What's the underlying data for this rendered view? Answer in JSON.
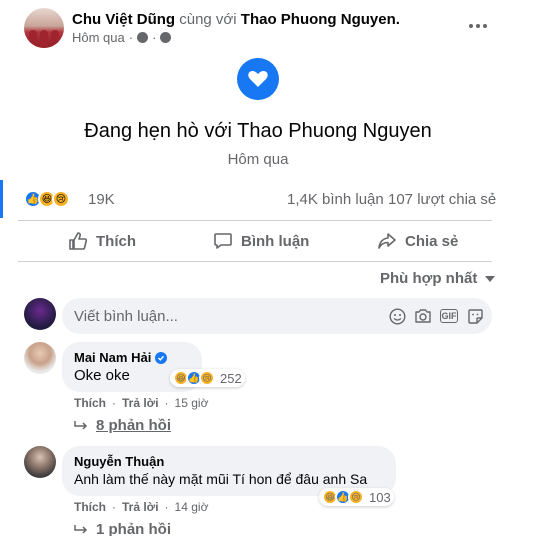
{
  "post": {
    "author": "Chu Việt Dũng",
    "with_word": "cùng với",
    "tagged": "Thao Phuong Nguyen",
    "time": "Hôm qua",
    "more_icon": "more-horizontal-icon"
  },
  "life_event": {
    "title": "Đang hẹn hò với Thao Phuong Nguyen",
    "date": "Hôm qua",
    "icon": "heart-icon"
  },
  "stats": {
    "reactions": "19K",
    "comments": "1,4K bình luận",
    "shares": "107 lượt chia sẻ"
  },
  "actions": {
    "like": "Thích",
    "comment": "Bình luận",
    "share": "Chia sẻ"
  },
  "sort": {
    "label": "Phù hợp nhất"
  },
  "composer": {
    "placeholder": "Viết bình luận..."
  },
  "comments": [
    {
      "name": "Mai Nam Hải",
      "verified": true,
      "text": "Oke oke",
      "reaction_count": "252",
      "like_label": "Thích",
      "reply_label": "Trả lời",
      "time": "15 giờ",
      "replies": "8 phản hồi"
    },
    {
      "name": "Nguyễn Thuận",
      "verified": false,
      "text": "Anh làm thế này mặt mũi Tí hon để đâu anh Sa",
      "reaction_count": "103",
      "like_label": "Thích",
      "reply_label": "Trả lời",
      "time": "14 giờ",
      "replies": "1 phản hồi"
    }
  ],
  "colors": {
    "accent": "#1877f2",
    "secondary_text": "#65676b",
    "bubble_bg": "#f0f2f5"
  }
}
